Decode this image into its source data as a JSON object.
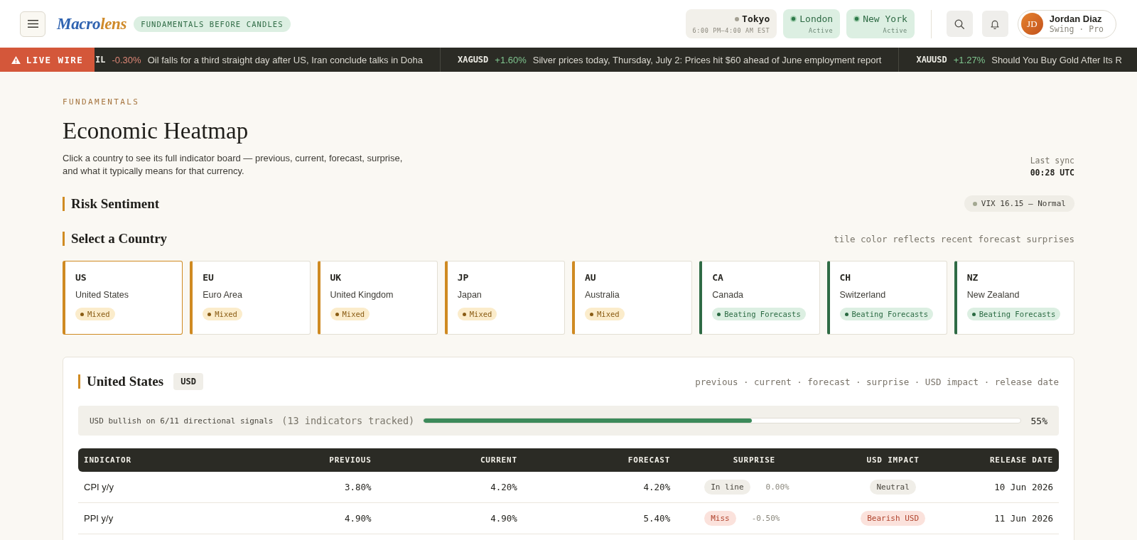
{
  "header": {
    "logo": {
      "first": "Macro",
      "second": "lens"
    },
    "tagline": "FUNDAMENTALS BEFORE CANDLES",
    "sessions": [
      {
        "city": "Tokyo",
        "detail": "6:00 PM–4:00 AM EST",
        "active": false
      },
      {
        "city": "London",
        "detail": "Active",
        "active": true
      },
      {
        "city": "New York",
        "detail": "Active",
        "active": true
      }
    ],
    "user": {
      "initials": "JD",
      "name": "Jordan Diaz",
      "plan": "Swing · Pro"
    }
  },
  "ticker": {
    "label": "LIVE WIRE",
    "items": [
      {
        "symbol": "IL",
        "change": "-0.30%",
        "color": "#de8777",
        "headline": "Oil falls for a third straight day after US, Iran conclude talks in Doha"
      },
      {
        "symbol": "XAGUSD",
        "change": "+1.60%",
        "color": "#7fc58f",
        "headline": "Silver prices today, Thursday, July 2: Prices hit $60 ahead of June employment report"
      },
      {
        "symbol": "XAUUSD",
        "change": "+1.27%",
        "color": "#7fc58f",
        "headline": "Should You Buy Gold After Its R"
      }
    ]
  },
  "page": {
    "eyebrow": "FUNDAMENTALS",
    "title": "Economic Heatmap",
    "description": "Click a country to see its full indicator board — previous, current, forecast, surprise, and what it typically means for that currency.",
    "sync_label": "Last sync",
    "sync_time": "00:28 UTC"
  },
  "risk_sentiment": {
    "title": "Risk Sentiment",
    "vix": "VIX 16.15 — Normal"
  },
  "country_select": {
    "title": "Select a Country",
    "hint": "tile color reflects recent forecast surprises",
    "countries": [
      {
        "code": "US",
        "name": "United States",
        "status": "Mixed",
        "kind": "mixed",
        "selected": true
      },
      {
        "code": "EU",
        "name": "Euro Area",
        "status": "Mixed",
        "kind": "mixed",
        "selected": false
      },
      {
        "code": "UK",
        "name": "United Kingdom",
        "status": "Mixed",
        "kind": "mixed",
        "selected": false
      },
      {
        "code": "JP",
        "name": "Japan",
        "status": "Mixed",
        "kind": "mixed",
        "selected": false
      },
      {
        "code": "AU",
        "name": "Australia",
        "status": "Mixed",
        "kind": "mixed",
        "selected": false
      },
      {
        "code": "CA",
        "name": "Canada",
        "status": "Beating Forecasts",
        "kind": "beating",
        "selected": false
      },
      {
        "code": "CH",
        "name": "Switzerland",
        "status": "Beating Forecasts",
        "kind": "beating",
        "selected": false
      },
      {
        "code": "NZ",
        "name": "New Zealand",
        "status": "Beating Forecasts",
        "kind": "beating",
        "selected": false
      }
    ]
  },
  "detail": {
    "title": "United States",
    "currency": "USD",
    "legend": "previous · current · forecast · surprise · USD impact · release date",
    "summary": "USD bullish on 6/11 directional signals",
    "tracked": "(13 indicators tracked)",
    "level": 0.55,
    "reading": "55%",
    "table": {
      "columns": [
        "INDICATOR",
        "PREVIOUS",
        "CURRENT",
        "FORECAST",
        "SURPRISE",
        "USD IMPACT",
        "RELEASE DATE"
      ],
      "rows": [
        {
          "indicator": "CPI y/y",
          "previous": "3.80%",
          "current": "4.20%",
          "forecast": "4.20%",
          "surprise": {
            "label": "In line",
            "kind": "inline",
            "value": "0.00%"
          },
          "impact": {
            "label": "Neutral",
            "kind": "neutral"
          },
          "release_date": "10 Jun 2026"
        },
        {
          "indicator": "PPI y/y",
          "previous": "4.90%",
          "current": "4.90%",
          "forecast": "5.40%",
          "surprise": {
            "label": "Miss",
            "kind": "miss",
            "value": "-0.50%"
          },
          "impact": {
            "label": "Bearish USD",
            "kind": "bearish"
          },
          "release_date": "11 Jun 2026"
        }
      ]
    }
  }
}
